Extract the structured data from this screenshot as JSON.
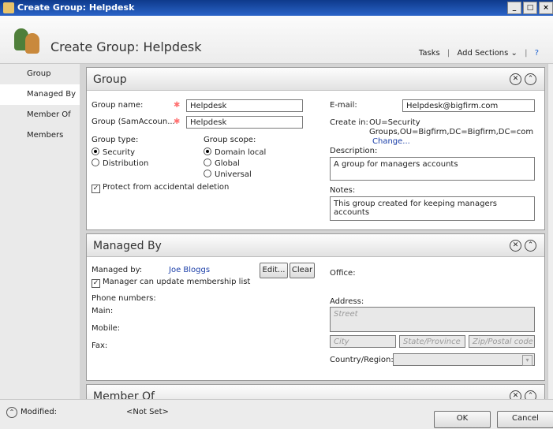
{
  "window": {
    "title": "Create Group: Helpdesk"
  },
  "header": {
    "title": "Create Group: Helpdesk",
    "tasks": "Tasks",
    "add_sections": "Add Sections"
  },
  "sidebar": {
    "items": [
      {
        "label": "Group"
      },
      {
        "label": "Managed By"
      },
      {
        "label": "Member Of"
      },
      {
        "label": "Members"
      }
    ]
  },
  "group": {
    "title": "Group",
    "group_name_label": "Group name:",
    "group_name_value": "Helpdesk",
    "sam_label": "Group (SamAccoun...",
    "sam_value": "Helpdesk",
    "group_type_label": "Group type:",
    "type_security": "Security",
    "type_distribution": "Distribution",
    "group_scope_label": "Group scope:",
    "scope_domain_local": "Domain local",
    "scope_global": "Global",
    "scope_universal": "Universal",
    "protect_label": "Protect from accidental deletion",
    "email_label": "E-mail:",
    "email_value": "Helpdesk@bigfirm.com",
    "create_in_label": "Create in:",
    "create_in_line1": "OU=Security",
    "create_in_line2": "Groups,OU=Bigfirm,DC=Bigfirm,DC=com",
    "change_link": "Change...",
    "description_label": "Description:",
    "description_value": "A group for managers accounts",
    "notes_label": "Notes:",
    "notes_value": "This group created for keeping managers accounts"
  },
  "managed_by": {
    "title": "Managed By",
    "managed_by_label": "Managed by:",
    "manager_name": "Joe Bloggs",
    "edit_button": "Edit...",
    "clear_button": "Clear",
    "update_membership_label": "Manager can update membership list",
    "phone_numbers_label": "Phone numbers:",
    "main_label": "Main:",
    "mobile_label": "Mobile:",
    "fax_label": "Fax:",
    "office_label": "Office:",
    "address_label": "Address:",
    "street_placeholder": "Street",
    "city_placeholder": "City",
    "state_placeholder": "State/Province",
    "zip_placeholder": "Zip/Postal code",
    "country_label": "Country/Region:"
  },
  "member_of": {
    "title": "Member Of"
  },
  "footer": {
    "modified_label": "Modified:",
    "modified_value": "<Not Set>",
    "ok_button": "OK",
    "cancel_button": "Cancel"
  }
}
